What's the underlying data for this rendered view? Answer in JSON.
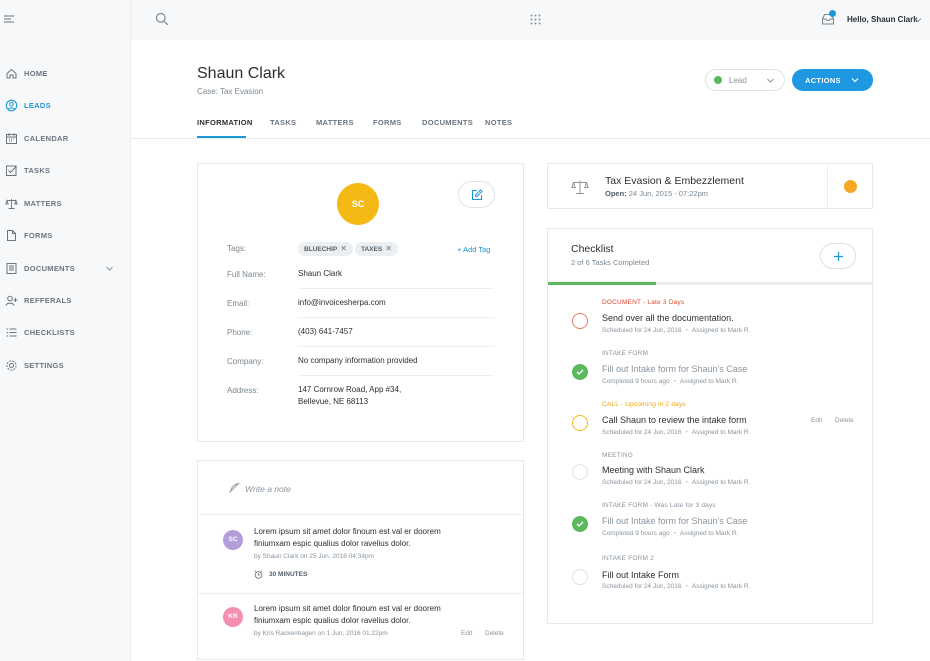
{
  "sidebar": {
    "items": [
      {
        "label": "HOME",
        "icon": "home-icon"
      },
      {
        "label": "LEADS",
        "icon": "user-circle-icon",
        "active": true
      },
      {
        "label": "CALENDAR",
        "icon": "calendar-icon"
      },
      {
        "label": "TASKS",
        "icon": "checkbox-icon"
      },
      {
        "label": "MATTERS",
        "icon": "scales-icon"
      },
      {
        "label": "FORMS",
        "icon": "form-icon"
      },
      {
        "label": "DOCUMENTS",
        "icon": "documents-icon"
      },
      {
        "label": "REFFERALS",
        "icon": "add-user-icon"
      },
      {
        "label": "CHECKLISTS",
        "icon": "list-icon"
      },
      {
        "label": "SETTINGS",
        "icon": "gear-icon"
      }
    ]
  },
  "topbar": {
    "greeting": "Hello, Shaun Clark"
  },
  "header": {
    "title": "Shaun Clark",
    "subtitle": "Case: Tax Evasion",
    "status": "Lead",
    "actions_label": "ACTIONS"
  },
  "tabs": [
    "INFORMATION",
    "TASKS",
    "MATTERS",
    "FORMS",
    "DOCUMENTS",
    "NOTES"
  ],
  "info": {
    "initials": "SC",
    "tags_label": "Tags:",
    "tags": [
      "BLUECHIP",
      "TAXES"
    ],
    "add_tag": "+ Add Tag",
    "fields": [
      {
        "label": "Full Name:",
        "value": "Shaun Clark"
      },
      {
        "label": "Email:",
        "value": "info@invoicesherpa.com"
      },
      {
        "label": "Phone:",
        "value": "(403) 641-7457"
      },
      {
        "label": "Company:",
        "value": "No company information provided"
      },
      {
        "label": "Address:",
        "value": "147 Cornrow Road, App #34,",
        "value2": "Bellevue, NE 68113"
      }
    ]
  },
  "notes": {
    "placeholder": "Write a note",
    "items": [
      {
        "initials": "SC",
        "text1": "Lorem ipsum sit amet dolor finoum est val er doorem",
        "text2": "finiumxam espic qualius dolor ravelius dolor.",
        "meta": "by Shaun Clark on 25 Jun, 2016 04:34pm",
        "time": "30 MINUTES"
      },
      {
        "initials": "KR",
        "text1": "Lorem ipsum sit amet dolor finoum est val er doorem",
        "text2": "finiumxam espic qualius dolor ravelius dolor.",
        "meta": "by Kris Rackenhagen on 1 Jun, 2016 01:22pm",
        "edit": "Edit",
        "delete": "Delete"
      }
    ]
  },
  "matter": {
    "title": "Tax Evasion & Embezzlement",
    "open_label": "Open:",
    "open_value": "24 Jun, 2015 - 07:22pm"
  },
  "checklist": {
    "title": "Checklist",
    "subtitle": "2 of 6 Tasks Completed",
    "progress": 0.333,
    "items": [
      {
        "category": "DOCUMENT - Late 3 Days",
        "name": "Send over all the documentation.",
        "scheduled": "Scheduled for 24 Jun, 2016",
        "assigned": "Assigned to Mark R.",
        "state": "late"
      },
      {
        "category": "INTAKE FORM",
        "name": "Fill out Intake form for Shaun's Case",
        "scheduled": "Completed 9 hours ago",
        "assigned": "Assigned to Mark R.",
        "state": "done"
      },
      {
        "category": "CALL - Upcoming in 2 days",
        "name": "Call Shaun to review the intake form",
        "scheduled": "Scheduled for 24 Jun, 2016",
        "assigned": "Assigned to Mark R.",
        "state": "upcoming",
        "edit": "Edit",
        "delete": "Delete"
      },
      {
        "category": "MEETING",
        "name": "Meeting with Shaun Clark",
        "scheduled": "Scheduled for 24 Jun, 2016",
        "assigned": "Assigned to Mark R.",
        "state": "open"
      },
      {
        "category": "INTAKE FORM - Was Late for 3 days",
        "name": "Fill out Intake form for Shaun's Case",
        "scheduled": "Completed 9 hours ago",
        "assigned": "Assigned to Mark R.",
        "state": "done"
      },
      {
        "category": "INTAKE FORM 2",
        "name": "Fill out Intake Form",
        "scheduled": "Scheduled for 24 Jun, 2016",
        "assigned": "Assigned to Mark R.",
        "state": "open"
      }
    ]
  },
  "colors": {
    "accent": "#1e98e0",
    "avatar_sc": "#f5b915",
    "avatar_note_sc": "#b39ddb",
    "avatar_note_kr": "#f48fb1",
    "success": "#5cb85c",
    "late": "#e2462a",
    "upcoming": "#f0a30a",
    "matter_dot": "#f5a623"
  }
}
